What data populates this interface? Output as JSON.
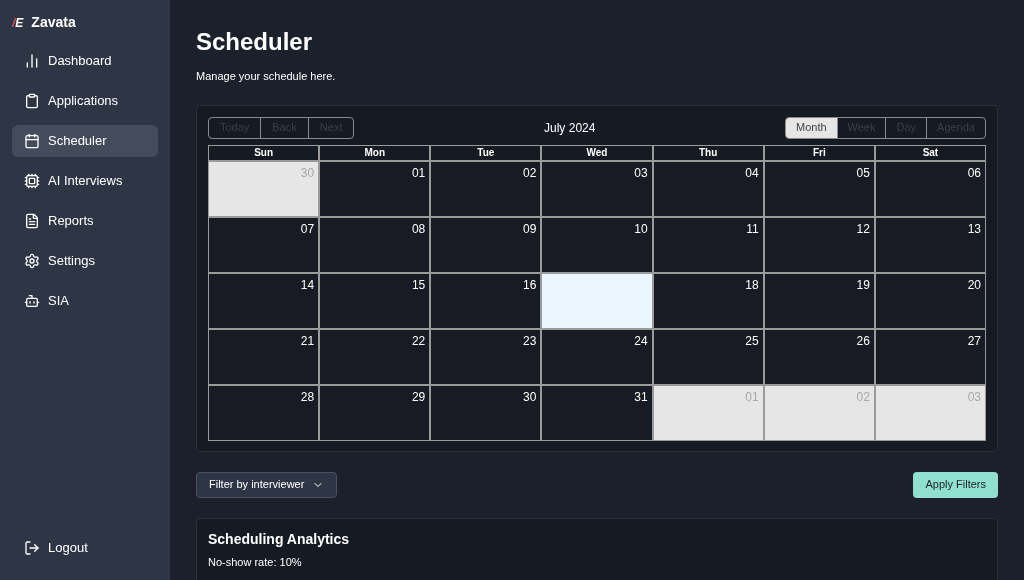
{
  "sidebar": {
    "brand": {
      "mark": "/E",
      "name": "Zavata"
    },
    "items": [
      {
        "label": "Dashboard",
        "selected": false
      },
      {
        "label": "Applications",
        "selected": false
      },
      {
        "label": "Scheduler",
        "selected": true
      },
      {
        "label": "AI Interviews",
        "selected": false
      },
      {
        "label": "Reports",
        "selected": false
      },
      {
        "label": "Settings",
        "selected": false
      },
      {
        "label": "SIA",
        "selected": false
      }
    ],
    "logout": {
      "label": "Logout"
    }
  },
  "page": {
    "title": "Scheduler",
    "subtitle": "Manage your schedule here."
  },
  "calendar": {
    "nav_buttons": [
      {
        "label": "Today",
        "disabled": true
      },
      {
        "label": "Back",
        "disabled": true
      },
      {
        "label": "Next",
        "disabled": true
      }
    ],
    "month_label": "July 2024",
    "views": [
      {
        "label": "Month",
        "selected": true
      },
      {
        "label": "Week",
        "selected": false
      },
      {
        "label": "Day",
        "selected": false
      },
      {
        "label": "Agenda",
        "selected": false
      }
    ],
    "weekdays": [
      "Sun",
      "Mon",
      "Tue",
      "Wed",
      "Thu",
      "Fri",
      "Sat"
    ],
    "weeks": [
      [
        {
          "day": "30",
          "kind": "outside"
        },
        {
          "day": "01",
          "kind": "current"
        },
        {
          "day": "02",
          "kind": "current"
        },
        {
          "day": "03",
          "kind": "current"
        },
        {
          "day": "04",
          "kind": "current"
        },
        {
          "day": "05",
          "kind": "current"
        },
        {
          "day": "06",
          "kind": "current"
        }
      ],
      [
        {
          "day": "07",
          "kind": "current"
        },
        {
          "day": "08",
          "kind": "current"
        },
        {
          "day": "09",
          "kind": "current"
        },
        {
          "day": "10",
          "kind": "current"
        },
        {
          "day": "11",
          "kind": "current"
        },
        {
          "day": "12",
          "kind": "current"
        },
        {
          "day": "13",
          "kind": "current"
        }
      ],
      [
        {
          "day": "14",
          "kind": "current"
        },
        {
          "day": "15",
          "kind": "current"
        },
        {
          "day": "16",
          "kind": "current"
        },
        {
          "kind": "today"
        },
        {
          "day": "18",
          "kind": "current"
        },
        {
          "day": "19",
          "kind": "current"
        },
        {
          "day": "20",
          "kind": "current"
        }
      ],
      [
        {
          "day": "21",
          "kind": "current"
        },
        {
          "day": "22",
          "kind": "current"
        },
        {
          "day": "23",
          "kind": "current"
        },
        {
          "day": "24",
          "kind": "current"
        },
        {
          "day": "25",
          "kind": "current"
        },
        {
          "day": "26",
          "kind": "current"
        },
        {
          "day": "27",
          "kind": "current"
        }
      ],
      [
        {
          "day": "28",
          "kind": "current"
        },
        {
          "day": "29",
          "kind": "current"
        },
        {
          "day": "30",
          "kind": "current"
        },
        {
          "day": "31",
          "kind": "current"
        },
        {
          "day": "01",
          "kind": "outside"
        },
        {
          "day": "02",
          "kind": "outside"
        },
        {
          "day": "03",
          "kind": "outside"
        }
      ]
    ]
  },
  "filters": {
    "dropdown": "Filter by interviewer",
    "apply": "Apply Filters"
  },
  "analytics": {
    "title": "Scheduling Analytics",
    "lines": [
      "No-show rate: 10%"
    ]
  }
}
